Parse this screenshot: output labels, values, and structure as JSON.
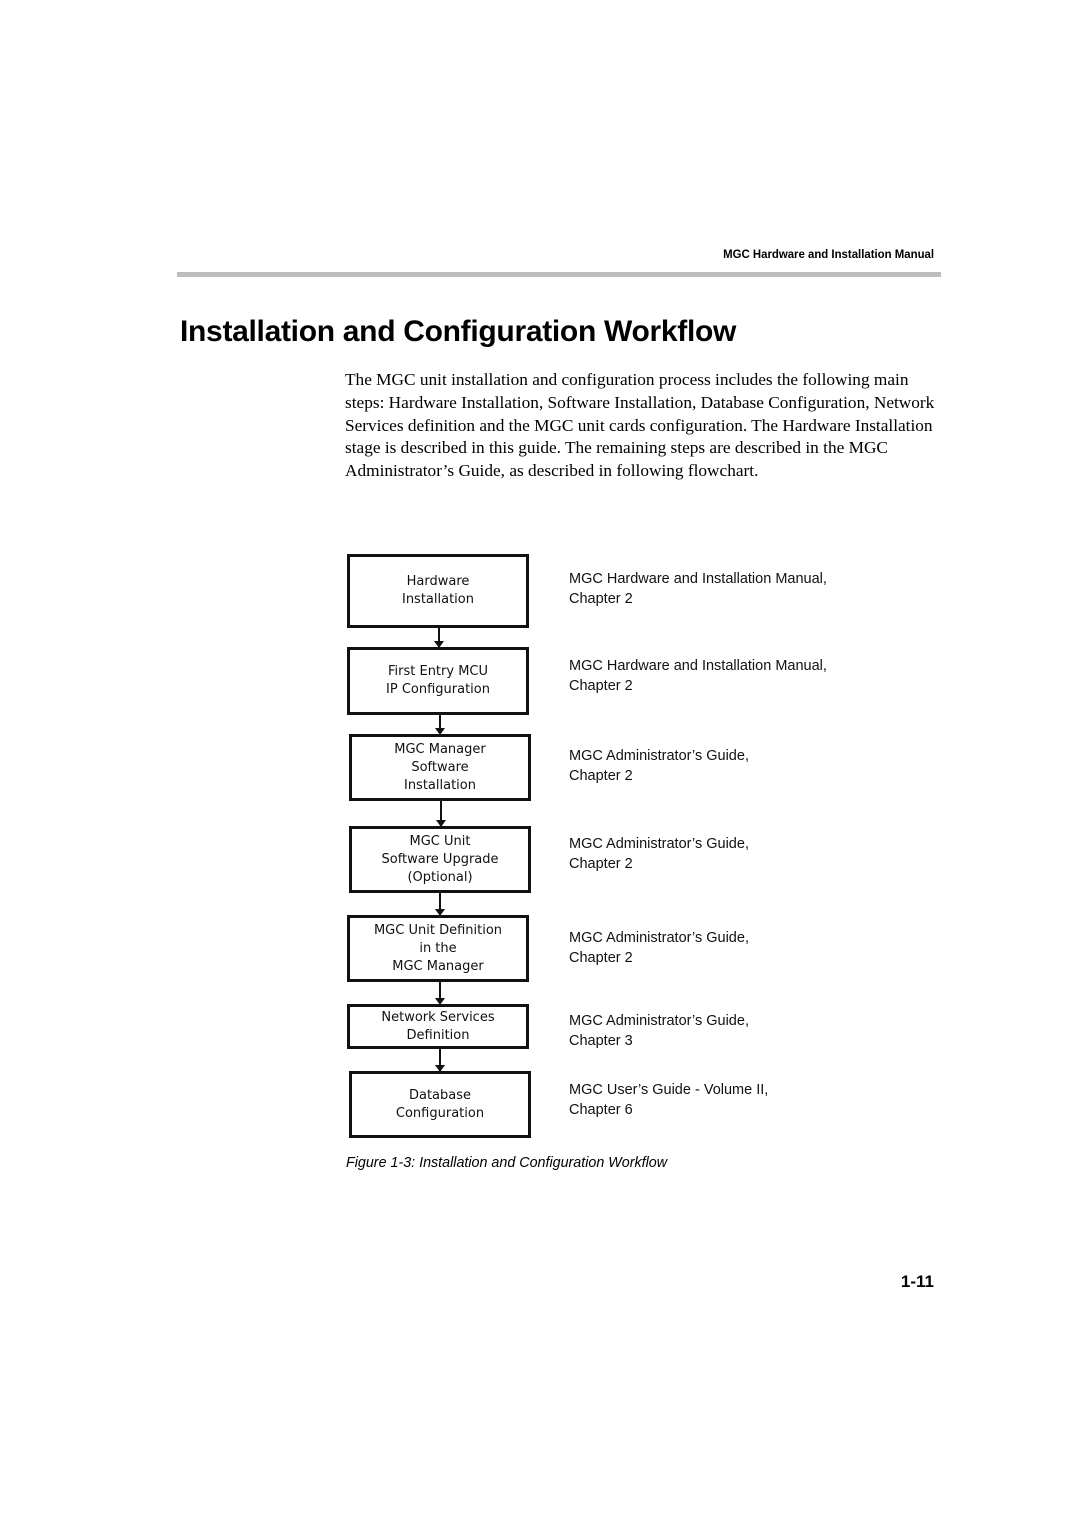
{
  "header": {
    "running_title": "MGC Hardware and Installation Manual"
  },
  "section": {
    "title": "Installation and Configuration Workflow",
    "paragraph": "The MGC unit installation and configuration process includes the following main steps: Hardware Installation, Software Installation, Database Configuration, Network Services definition and the MGC unit cards configuration. The Hardware Installation stage is described in this guide. The remaining steps are described in the MGC Administrator’s Guide, as described in following flowchart."
  },
  "flowchart": {
    "steps": [
      {
        "lines": [
          "Hardware",
          "Installation"
        ],
        "reference": [
          "MGC Hardware and Installation Manual,",
          "Chapter 2"
        ]
      },
      {
        "lines": [
          "First Entry MCU",
          "IP Configuration"
        ],
        "reference": [
          "MGC Hardware and Installation Manual,",
          "Chapter 2"
        ]
      },
      {
        "lines": [
          "MGC Manager",
          "Software",
          "Installation"
        ],
        "reference": [
          "MGC Administrator’s Guide,",
          "Chapter 2"
        ]
      },
      {
        "lines": [
          "MGC Unit",
          "Software Upgrade",
          "(Optional)"
        ],
        "reference": [
          "MGC Administrator’s Guide,",
          "Chapter 2"
        ]
      },
      {
        "lines": [
          "MGC Unit Definition",
          "in the",
          "MGC Manager"
        ],
        "reference": [
          "MGC Administrator’s Guide,",
          "Chapter 2"
        ]
      },
      {
        "lines": [
          "Network Services",
          "Definition"
        ],
        "reference": [
          "MGC Administrator’s Guide,",
          "Chapter 3"
        ]
      },
      {
        "lines": [
          "Database",
          "Configuration"
        ],
        "reference": [
          "MGC User’s Guide - Volume II,",
          "Chapter 6"
        ]
      }
    ]
  },
  "figure": {
    "caption": "Figure 1-3: Installation and Configuration Workflow"
  },
  "footer": {
    "page_number": "1-11"
  }
}
